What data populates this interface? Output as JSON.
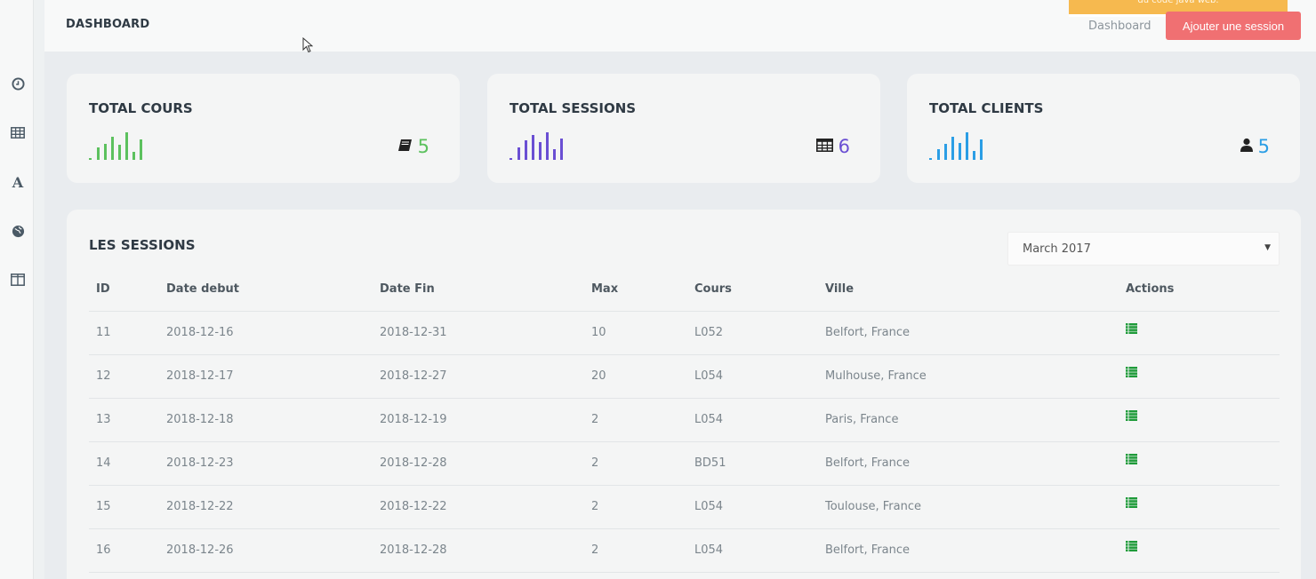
{
  "header": {
    "title": "DASHBOARD",
    "breadcrumb": "Dashboard",
    "add_button": "Ajouter une session",
    "toast_text": "du code java web."
  },
  "colors": {
    "accent_button": "#f07072",
    "cours": "#5cc15e",
    "sessions": "#6a4fd3",
    "clients": "#2b9ee5",
    "action_icon": "#1f9b3a",
    "toast": "#f6b94f"
  },
  "sidebar": {
    "items": [
      {
        "icon": "clock-icon"
      },
      {
        "icon": "table-icon"
      },
      {
        "icon": "font-icon"
      },
      {
        "icon": "globe-icon"
      },
      {
        "icon": "columns-icon"
      }
    ]
  },
  "stats": {
    "cours": {
      "title": "TOTAL COURS",
      "value": "5",
      "icon": "book-icon"
    },
    "sessions": {
      "title": "TOTAL SESSIONS",
      "value": "6",
      "icon": "table-icon"
    },
    "clients": {
      "title": "TOTAL CLIENTS",
      "value": "5",
      "icon": "user-icon"
    }
  },
  "sessions": {
    "title": "LES SESSIONS",
    "month_selected": "March 2017",
    "columns": [
      "ID",
      "Date debut",
      "Date Fin",
      "Max",
      "Cours",
      "Ville",
      "Actions"
    ],
    "rows": [
      {
        "id": "11",
        "debut": "2018-12-16",
        "fin": "2018-12-31",
        "max": "10",
        "cours": "L052",
        "ville": "Belfort, France"
      },
      {
        "id": "12",
        "debut": "2018-12-17",
        "fin": "2018-12-27",
        "max": "20",
        "cours": "L054",
        "ville": "Mulhouse, France"
      },
      {
        "id": "13",
        "debut": "2018-12-18",
        "fin": "2018-12-19",
        "max": "2",
        "cours": "L054",
        "ville": "Paris, France"
      },
      {
        "id": "14",
        "debut": "2018-12-23",
        "fin": "2018-12-28",
        "max": "2",
        "cours": "BD51",
        "ville": "Belfort, France"
      },
      {
        "id": "15",
        "debut": "2018-12-22",
        "fin": "2018-12-22",
        "max": "2",
        "cours": "L054",
        "ville": "Toulouse, France"
      },
      {
        "id": "16",
        "debut": "2018-12-26",
        "fin": "2018-12-28",
        "max": "2",
        "cours": "L054",
        "ville": "Belfort, France"
      }
    ]
  }
}
